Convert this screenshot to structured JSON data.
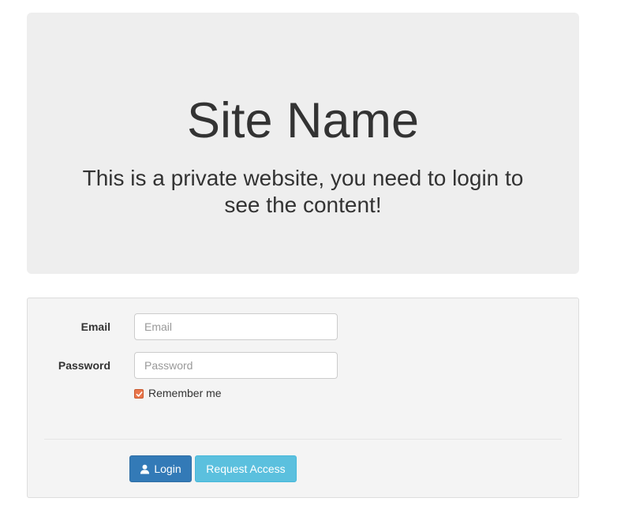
{
  "header": {
    "site_name": "Site Name",
    "lead_text": "This is a private website, you need to login to see the content!"
  },
  "login_form": {
    "email_label": "Email",
    "email_placeholder": "Email",
    "email_value": "",
    "password_label": "Password",
    "password_placeholder": "Password",
    "password_value": "",
    "remember_label": "Remember me",
    "remember_checked": true,
    "login_button": "Login",
    "login_icon": "user-icon",
    "request_button": "Request Access"
  },
  "colors": {
    "jumbotron_bg": "#eeeeee",
    "well_bg": "#f4f4f4",
    "primary": "#337ab7",
    "info": "#5bc0de",
    "checkbox": "#e9754a"
  }
}
